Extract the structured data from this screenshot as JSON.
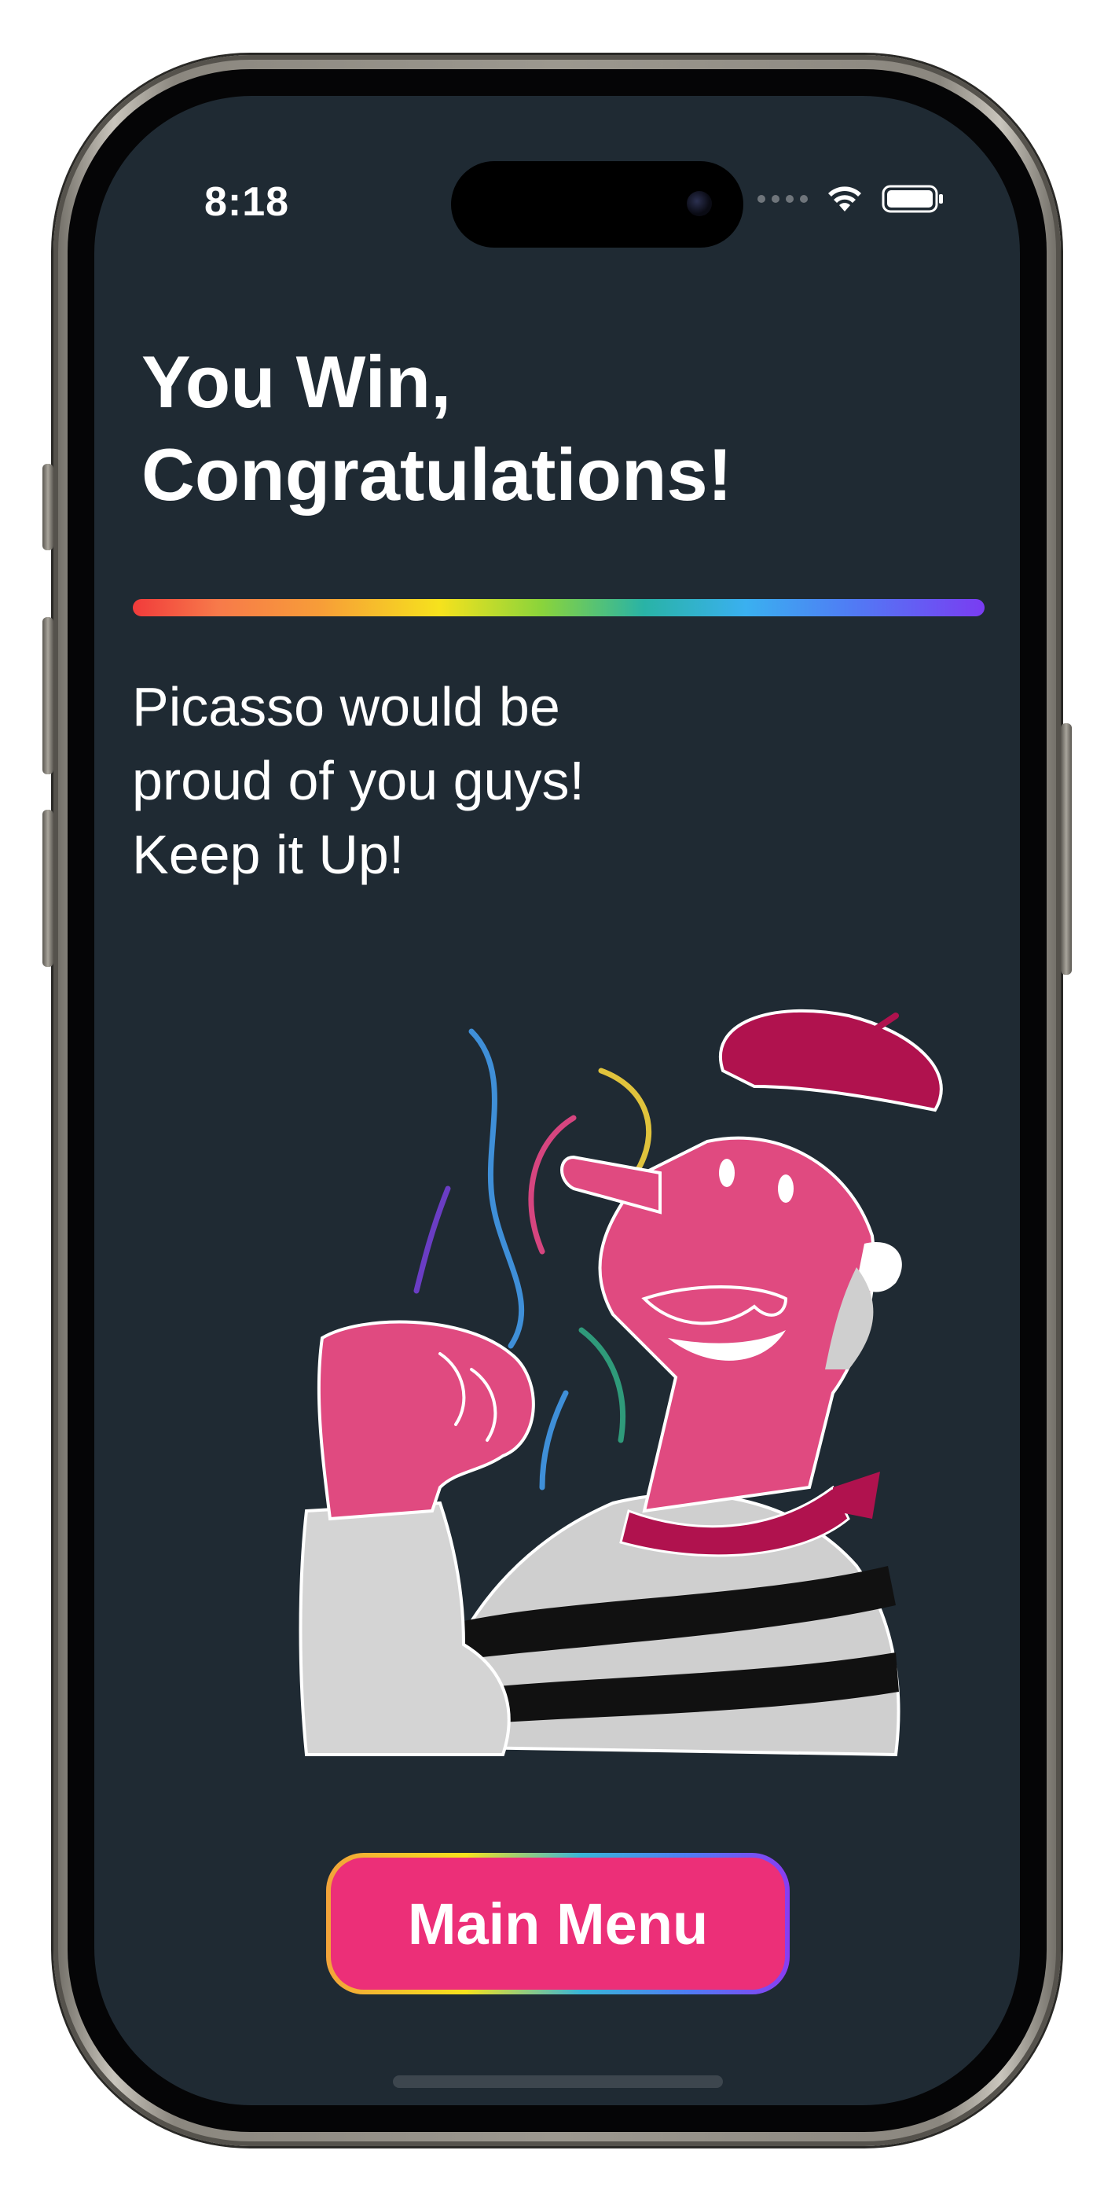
{
  "status_bar": {
    "time": "8:18",
    "signal_icon": "cellular-dots-icon",
    "wifi_icon": "wifi-icon",
    "battery_icon": "battery-icon"
  },
  "screen": {
    "title_line1": "You Win,",
    "title_line2": "Congratulations!",
    "message_line1": "Picasso would be",
    "message_line2": "proud of you guys!",
    "message_line3": "Keep it Up!",
    "illustration_icon": "artist-beret-illustration",
    "main_menu_label": "Main Menu"
  },
  "colors": {
    "background": "#1f2a33",
    "button": "#ec2f78",
    "text": "#ffffff",
    "character_pink": "#e04a80",
    "beret_crimson": "#b0124e"
  }
}
